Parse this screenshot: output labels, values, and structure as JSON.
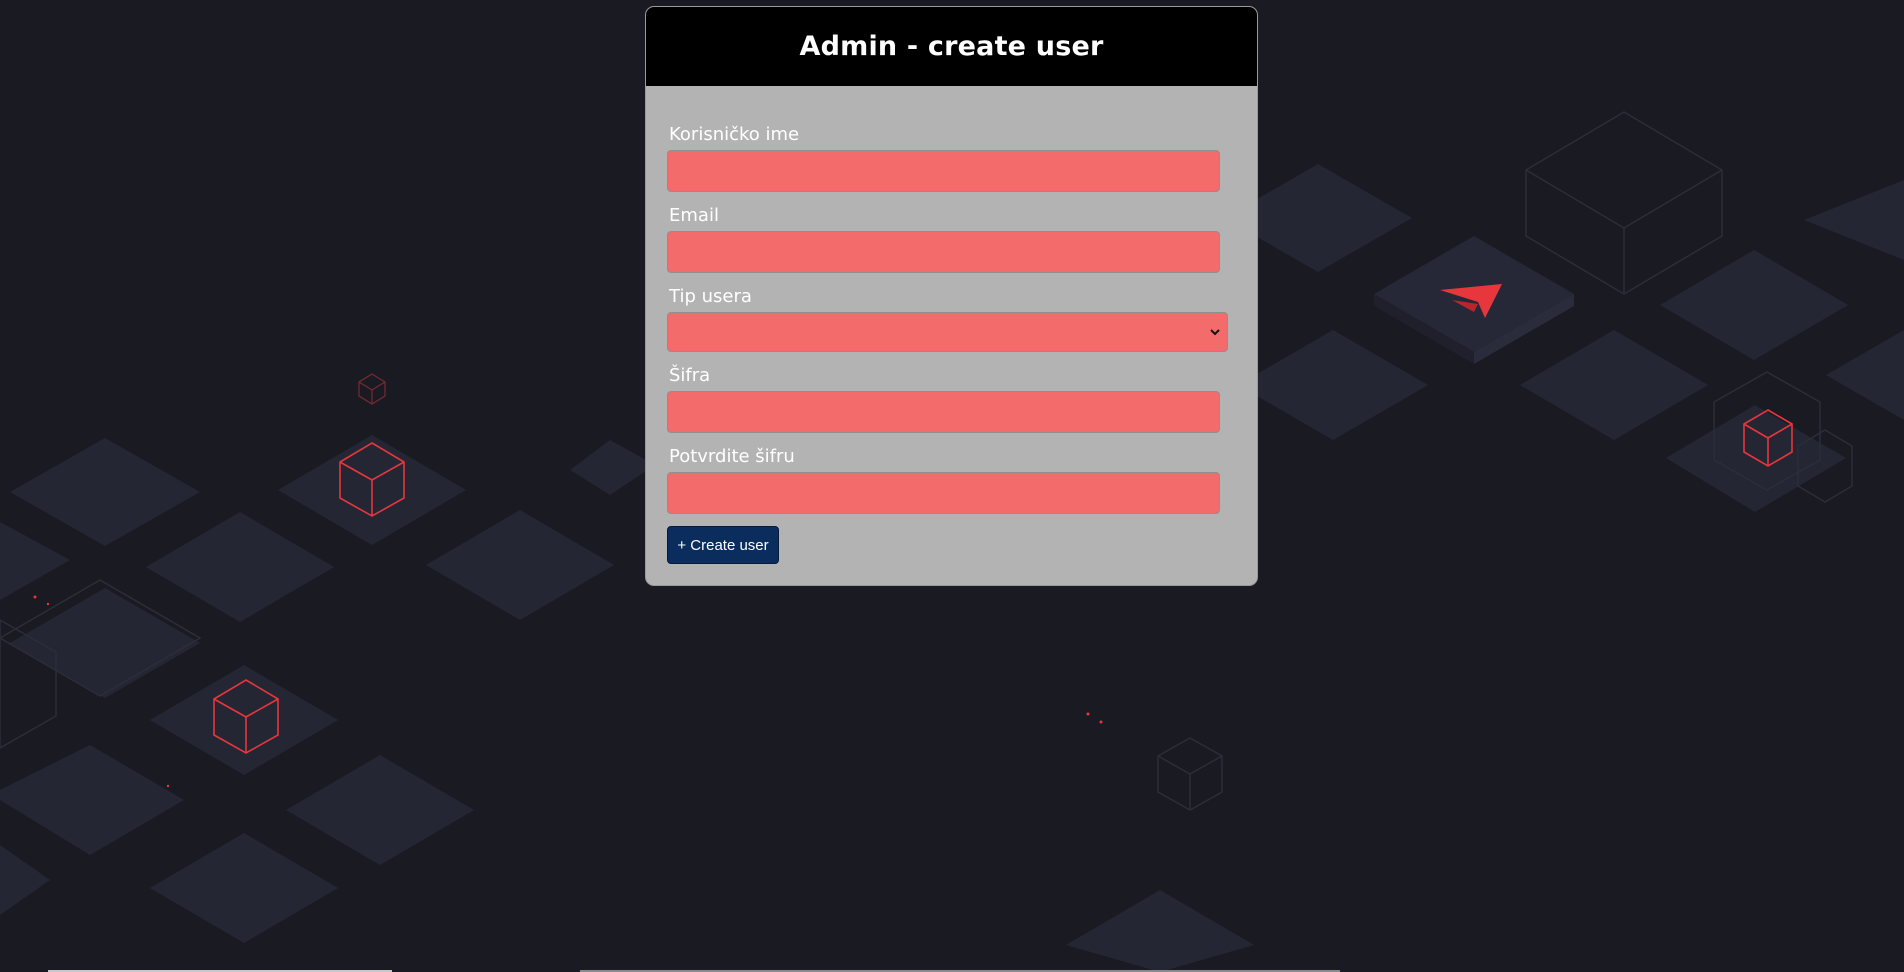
{
  "form": {
    "title": "Admin - create user",
    "fields": [
      {
        "label": "Korisničko ime",
        "value": "",
        "placeholder": ""
      },
      {
        "label": "Email",
        "value": "",
        "placeholder": ""
      },
      {
        "label": "Tip usera",
        "value": ""
      },
      {
        "label": "Šifra",
        "value": "",
        "placeholder": ""
      },
      {
        "label": "Potvrdite šifru",
        "value": "",
        "placeholder": ""
      }
    ],
    "submit_label": "+ Create user"
  },
  "colors": {
    "page_background": "#1a1a22",
    "panel_background": "#b3b3b3",
    "header_background": "#000000",
    "input_background": "#f36b6b",
    "button_background": "#0b2d5e",
    "accent_red": "#e8363d"
  },
  "icons": {
    "select_chevron": "chevron-down-icon",
    "background_logo": "arrow-logo-icon"
  }
}
